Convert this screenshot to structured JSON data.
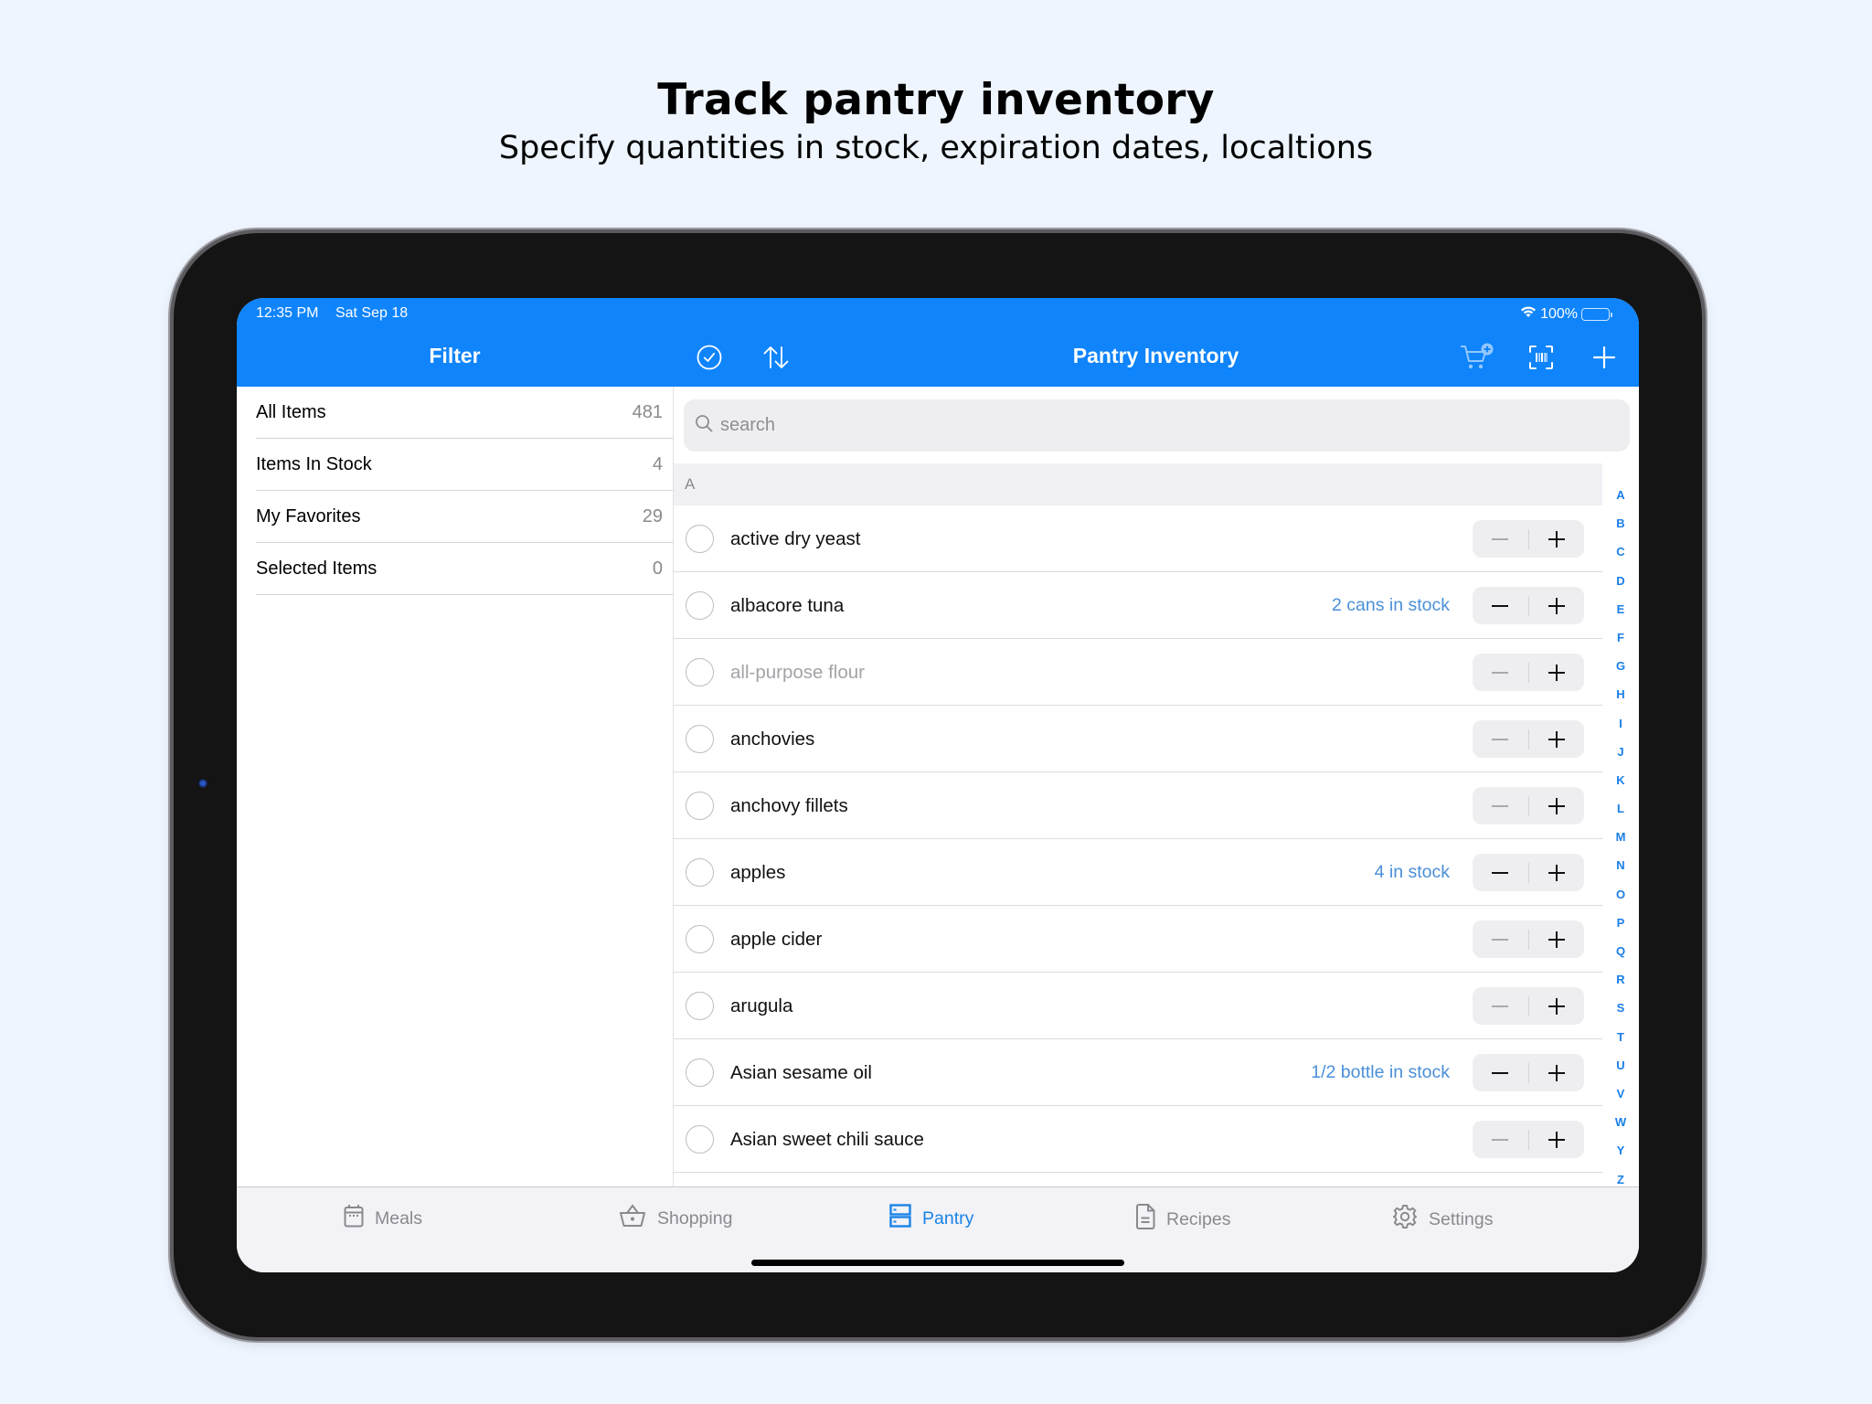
{
  "promo": {
    "headline": "Track pantry inventory",
    "subhead": "Specify quantities in stock, expiration dates, localtions"
  },
  "status_bar": {
    "time": "12:35 PM",
    "date": "Sat Sep 18",
    "battery": "100%",
    "battery_level": 1.0
  },
  "nav": {
    "sidebar_title": "Filter",
    "main_title": "Pantry Inventory",
    "icons": {
      "select": "checkmark-circle-icon",
      "sort": "sort-arrows-icon",
      "add_to_cart": "cart-plus-icon",
      "scan": "barcode-scan-icon",
      "add": "plus-icon"
    }
  },
  "colors": {
    "accent": "#0f84fb",
    "stock_text": "#4a8fd9",
    "tab_active": "#1a83e6",
    "tab_inactive": "#8a8a8e"
  },
  "sidebar": {
    "filters": [
      {
        "label": "All Items",
        "count": "481",
        "active": true
      },
      {
        "label": "Items In Stock",
        "count": "4",
        "active": false
      },
      {
        "label": "My Favorites",
        "count": "29",
        "active": false
      },
      {
        "label": "Selected Items",
        "count": "0",
        "active": false
      }
    ]
  },
  "search": {
    "placeholder": "search",
    "value": ""
  },
  "list": {
    "section": "A",
    "items": [
      {
        "name": "active dry yeast",
        "stock": "",
        "dim": false,
        "minus_enabled": false
      },
      {
        "name": "albacore tuna",
        "stock": "2 cans in stock",
        "dim": false,
        "minus_enabled": true
      },
      {
        "name": "all-purpose flour",
        "stock": "",
        "dim": true,
        "minus_enabled": false
      },
      {
        "name": "anchovies",
        "stock": "",
        "dim": false,
        "minus_enabled": false
      },
      {
        "name": "anchovy fillets",
        "stock": "",
        "dim": false,
        "minus_enabled": false
      },
      {
        "name": "apples",
        "stock": "4 in stock",
        "dim": false,
        "minus_enabled": true
      },
      {
        "name": "apple cider",
        "stock": "",
        "dim": false,
        "minus_enabled": false
      },
      {
        "name": "arugula",
        "stock": "",
        "dim": false,
        "minus_enabled": false
      },
      {
        "name": "Asian sesame oil",
        "stock": "1/2 bottle in stock",
        "dim": false,
        "minus_enabled": true
      },
      {
        "name": "Asian sweet chili sauce",
        "stock": "",
        "dim": false,
        "minus_enabled": false
      },
      {
        "name": "",
        "stock": "",
        "dim": false,
        "minus_enabled": false
      }
    ],
    "index_letters": [
      "A",
      "B",
      "C",
      "D",
      "E",
      "F",
      "G",
      "H",
      "I",
      "J",
      "K",
      "L",
      "M",
      "N",
      "O",
      "P",
      "Q",
      "R",
      "S",
      "T",
      "U",
      "V",
      "W",
      "Y",
      "Z"
    ]
  },
  "tabbar": {
    "tabs": [
      {
        "label": "Meals",
        "icon": "calendar-icon",
        "active": false
      },
      {
        "label": "Shopping",
        "icon": "basket-icon",
        "active": false
      },
      {
        "label": "Pantry",
        "icon": "pantry-shelves-icon",
        "active": true
      },
      {
        "label": "Recipes",
        "icon": "document-icon",
        "active": false
      },
      {
        "label": "Settings",
        "icon": "gear-icon",
        "active": false
      }
    ]
  }
}
